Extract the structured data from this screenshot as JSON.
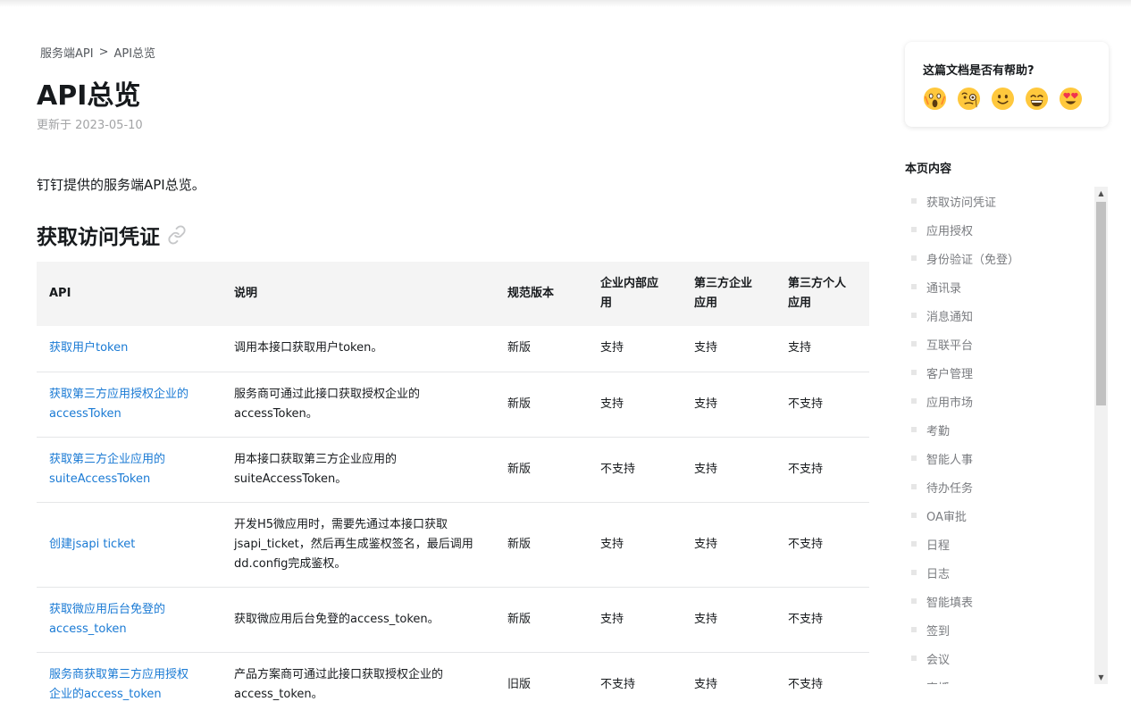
{
  "breadcrumb": {
    "parent": "服务端API",
    "separator": ">",
    "current": "API总览"
  },
  "page": {
    "title": "API总览",
    "updated": "更新于 2023-05-10",
    "intro": "钉钉提供的服务端API总览。",
    "section_title": "获取访问凭证"
  },
  "table": {
    "headers": {
      "api": "API",
      "desc": "说明",
      "version": "规范版本",
      "internal_line1": "企业内部应",
      "internal_line2": "用",
      "third_corp_line1": "第三方企业",
      "third_corp_line2": "应用",
      "third_personal_line1": "第三方个人",
      "third_personal_line2": "应用"
    },
    "rows": [
      {
        "api_line1": "获取用户token",
        "api_line2": "",
        "desc_line1": "调用本接口获取用户token。",
        "desc_line2": "",
        "desc_line3": "",
        "version": "新版",
        "internal": "支持",
        "third_corp": "支持",
        "third_personal": "支持"
      },
      {
        "api_line1": "获取第三方应用授权企业的",
        "api_line2": "accessToken",
        "desc_line1": "服务商可通过此接口获取授权企业的",
        "desc_line2": "accessToken。",
        "desc_line3": "",
        "version": "新版",
        "internal": "支持",
        "third_corp": "支持",
        "third_personal": "不支持"
      },
      {
        "api_line1": "获取第三方企业应用的",
        "api_line2": "suiteAccessToken",
        "desc_line1": "用本接口获取第三方企业应用的",
        "desc_line2": "suiteAccessToken。",
        "desc_line3": "",
        "version": "新版",
        "internal": "不支持",
        "third_corp": "支持",
        "third_personal": "不支持"
      },
      {
        "api_line1": "创建jsapi ticket",
        "api_line2": "",
        "desc_line1": "开发H5微应用时，需要先通过本接口获取",
        "desc_line2": "jsapi_ticket，然后再生成鉴权签名，最后调用",
        "desc_line3": "dd.config完成鉴权。",
        "version": "新版",
        "internal": "支持",
        "third_corp": "支持",
        "third_personal": "不支持"
      },
      {
        "api_line1": "获取微应用后台免登的",
        "api_line2": "access_token",
        "desc_line1": "获取微应用后台免登的access_token。",
        "desc_line2": "",
        "desc_line3": "",
        "version": "新版",
        "internal": "支持",
        "third_corp": "支持",
        "third_personal": "不支持"
      },
      {
        "api_line1": "服务商获取第三方应用授权",
        "api_line2": "企业的access_token",
        "desc_line1": "产品方案商可通过此接口获取授权企业的",
        "desc_line2": "access_token。",
        "desc_line3": "",
        "version": "旧版",
        "internal": "不支持",
        "third_corp": "支持",
        "third_personal": "不支持"
      }
    ]
  },
  "feedback": {
    "title": "这篇文档是否有帮助?",
    "emojis": [
      "scream-face-icon",
      "face-with-monocle-icon",
      "slightly-smiling-face-icon",
      "grinning-face-icon",
      "heart-eyes-face-icon"
    ]
  },
  "toc": {
    "title": "本页内容",
    "items": [
      "获取访问凭证",
      "应用授权",
      "身份验证（免登）",
      "通讯录",
      "消息通知",
      "互联平台",
      "客户管理",
      "应用市场",
      "考勤",
      "智能人事",
      "待办任务",
      "OA审批",
      "日程",
      "日志",
      "智能填表",
      "签到",
      "会议",
      "直播"
    ]
  },
  "colors": {
    "link": "#1a7ad4",
    "header_bg": "#f4f4f4",
    "text": "#171a1d",
    "muted": "#a2a3a5",
    "emoji_face": "#ffc83d"
  }
}
